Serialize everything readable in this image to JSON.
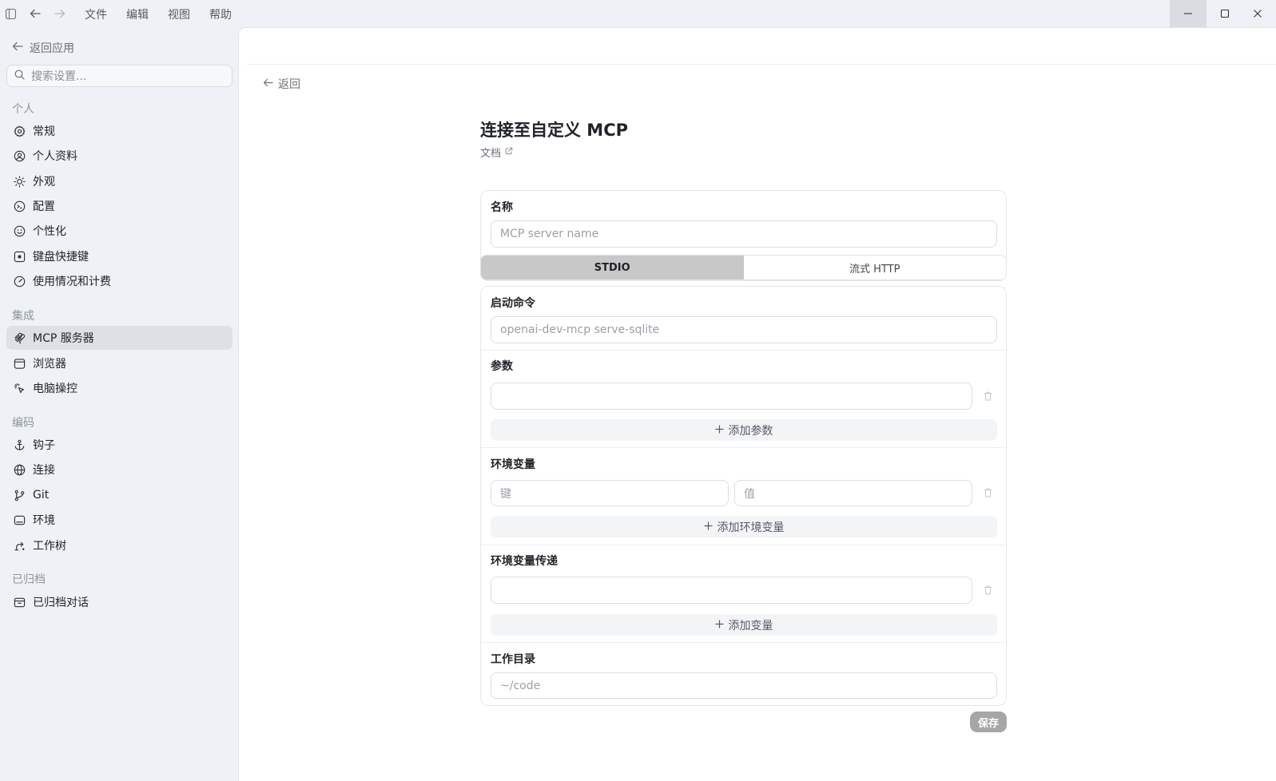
{
  "titlebar": {
    "menu": [
      "文件",
      "编辑",
      "视图",
      "帮助"
    ]
  },
  "sidebar": {
    "back_label": "返回应用",
    "search_placeholder": "搜索设置...",
    "sections": [
      {
        "label": "个人",
        "items": [
          {
            "label": "常规",
            "icon": "gear-icon"
          },
          {
            "label": "个人资料",
            "icon": "user-circle-icon"
          },
          {
            "label": "外观",
            "icon": "sun-icon"
          },
          {
            "label": "配置",
            "icon": "config-icon"
          },
          {
            "label": "个性化",
            "icon": "personalize-icon"
          },
          {
            "label": "键盘快捷键",
            "icon": "keyboard-icon"
          },
          {
            "label": "使用情况和计费",
            "icon": "gauge-icon"
          }
        ]
      },
      {
        "label": "集成",
        "items": [
          {
            "label": "MCP 服务器",
            "icon": "mcp-icon",
            "active": true
          },
          {
            "label": "浏览器",
            "icon": "browser-icon"
          },
          {
            "label": "电脑操控",
            "icon": "cursor-sparkle-icon"
          }
        ]
      },
      {
        "label": "编码",
        "items": [
          {
            "label": "钩子",
            "icon": "anchor-icon"
          },
          {
            "label": "连接",
            "icon": "globe-icon"
          },
          {
            "label": "Git",
            "icon": "git-branch-icon"
          },
          {
            "label": "环境",
            "icon": "terminal-icon"
          },
          {
            "label": "工作树",
            "icon": "worktree-icon"
          }
        ]
      },
      {
        "label": "已归档",
        "items": [
          {
            "label": "已归档对话",
            "icon": "archive-icon"
          }
        ]
      }
    ]
  },
  "main": {
    "back_label": "返回",
    "title": "连接至自定义 MCP",
    "doc_label": "文档",
    "name": {
      "label": "名称",
      "placeholder": "MCP server name"
    },
    "transport": {
      "options": [
        "STDIO",
        "流式 HTTP"
      ],
      "selected": "STDIO"
    },
    "command": {
      "label": "启动命令",
      "placeholder": "openai-dev-mcp serve-sqlite"
    },
    "args": {
      "label": "参数",
      "value": "",
      "add_label": "添加参数"
    },
    "env": {
      "label": "环境变量",
      "key_placeholder": "键",
      "value_placeholder": "值",
      "add_label": "添加环境变量"
    },
    "env_passthrough": {
      "label": "环境变量传递",
      "value": "",
      "add_label": "添加变量"
    },
    "workdir": {
      "label": "工作目录",
      "placeholder": "~/code"
    },
    "save_label": "保存"
  },
  "colors": {
    "sidebar_bg": "#eef1f5",
    "active_item": "#dde1e6",
    "segment_active": "#c8c8c8",
    "save_disabled": "#a6a6a6"
  }
}
